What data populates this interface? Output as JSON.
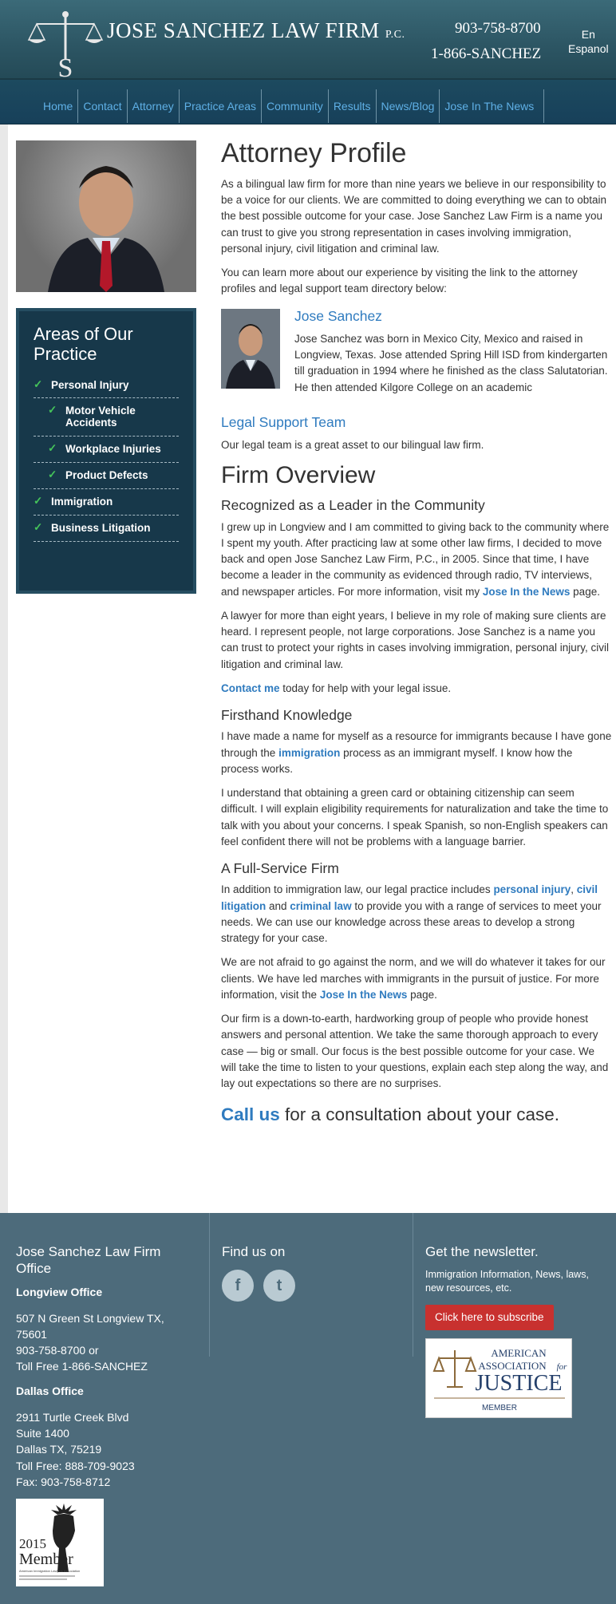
{
  "header": {
    "brand": "JOSE SANCHEZ LAW FIRM",
    "brand_suffix": "P.C.",
    "logo_letter": "S",
    "phone1": "903-758-8700",
    "phone2": "1-866-SANCHEZ",
    "lang1": "En",
    "lang2": "Espanol",
    "colors": {
      "header_bg": "#2c5563",
      "nav_link": "#5fb0e6"
    }
  },
  "nav": [
    "Home",
    "Contact",
    "Attorney",
    "Practice Areas",
    "Community",
    "Results",
    "News/Blog",
    "Jose In The News"
  ],
  "sidebar": {
    "areas_title": "Areas of Our Practice",
    "items": [
      {
        "label": "Personal Injury",
        "sub": false
      },
      {
        "label": "Motor Vehicle Accidents",
        "sub": true
      },
      {
        "label": "Workplace Injuries",
        "sub": true
      },
      {
        "label": "Product Defects",
        "sub": true
      },
      {
        "label": "Immigration",
        "sub": false
      },
      {
        "label": "Business Litigation",
        "sub": false
      }
    ],
    "check_icon": "check-icon"
  },
  "content": {
    "title": "Attorney Profile",
    "intro1": "As a bilingual law firm for more than nine years we believe in our responsibility to be a voice for our clients. We are committed to doing everything we can to obtain the best possible outcome for your case. Jose Sanchez Law Firm is a name you can trust to give you strong representation in cases involving immigration, personal injury, civil litigation and criminal law.",
    "intro2": "You can learn more about our experience by visiting the link to the attorney profiles and legal support team directory below:",
    "attorney_name": "Jose Sanchez",
    "attorney_bio": "Jose Sanchez was born in Mexico City, Mexico and raised in Longview, Texas. Jose attended Spring Hill ISD from kindergarten till graduation in 1994 where he finished as the class Salutatorian. He then attended Kilgore College on an academic",
    "support_title": "Legal Support Team",
    "support_text": "Our legal team is a great asset to our bilingual law firm.",
    "overview_title": "Firm Overview",
    "leader_title": "Recognized as a Leader in the Community",
    "leader_p1_a": "I grew up in Longview and I am committed to giving back to the community where I spent my youth. After practicing law at some other law firms, I decided to move back and open Jose Sanchez Law Firm, P.C., in 2005. Since that time, I have become a leader in the community as evidenced through radio, TV interviews, and newspaper articles. For more information, visit my ",
    "leader_p1_link": "Jose In the News",
    "leader_p1_b": " page.",
    "leader_p2": "A lawyer for more than eight years, I believe in my role of making sure clients are heard. I represent people, not large corporations. Jose Sanchez is a name you can trust to protect your rights in cases involving immigration, personal injury, civil litigation and criminal law.",
    "contact_link": "Contact me",
    "contact_rest": " today for help with your legal issue.",
    "firsthand_title": "Firsthand Knowledge",
    "firsthand_p1_a": "I have made a name for myself as a resource for immigrants because I have gone through the ",
    "firsthand_p1_link": "immigration",
    "firsthand_p1_b": " process as an immigrant myself. I know how the process works.",
    "firsthand_p2": "I understand that obtaining a green card or obtaining citizenship can seem difficult. I will explain eligibility requirements for naturalization and take the time to talk with you about your concerns. I speak Spanish, so non-English speakers can feel confident there will not be problems with a language barrier.",
    "fullservice_title": "A Full-Service Firm",
    "fs_p1_a": "In addition to immigration law, our legal practice includes ",
    "fs_link1": "personal injury",
    "fs_comma": ",",
    "fs_link2": "civil litigation",
    "fs_and": " and ",
    "fs_link3": "criminal law",
    "fs_p1_b": " to provide you with a range of services to meet your needs. We can use our knowledge across these areas to develop a strong strategy for your case.",
    "fs_p2_a": "We are not afraid to go against the norm, and we will do whatever it takes for our clients. We have led marches with immigrants in the pursuit of justice. For more information, visit the ",
    "fs_p2_link": "Jose In the News",
    "fs_p2_b": " page.",
    "fs_p3": "Our firm is a down-to-earth, hardworking group of people who provide honest answers and personal attention. We take the same thorough approach to every case — big or small. Our focus is the best possible outcome for your case. We will take the time to listen to your questions, explain each step along the way, and lay out expectations so there are no surprises.",
    "callus_link": "Call us",
    "callus_rest": " for a consultation about your case."
  },
  "footer": {
    "office_title": "Jose Sanchez Law Firm Office",
    "longview_label": "Longview Office",
    "longview_addr": [
      "507 N Green St Longview TX,",
      "75601",
      "903-758-8700 or",
      "Toll Free 1-866-SANCHEZ"
    ],
    "dallas_label": "Dallas Office",
    "dallas_addr": [
      "2911 Turtle Creek Blvd",
      "Suite 1400",
      "Dallas TX, 75219",
      "Toll Free: 888-709-9023",
      "Fax: 903-758-8712"
    ],
    "find_us": "Find us on",
    "facebook_glyph": "f",
    "twitter_glyph": "t",
    "newsletter_title": "Get the newsletter.",
    "newsletter_text": "Immigration Information, News, laws, new resources, etc.",
    "subscribe_btn": "Click here to subscribe",
    "aaj_line1": "AMERICAN",
    "aaj_line2": "ASSOCIATION",
    "aaj_for": "for",
    "aaj_line3": "JUSTICE",
    "aaj_member": "MEMBER",
    "badge_year": "2015",
    "badge_member": "Member",
    "badge_org": "American Immigration Lawyers Association",
    "colors": {
      "footer_bg": "#4d6b7b",
      "button": "#c8312f",
      "link": "#2f7bbf"
    }
  }
}
